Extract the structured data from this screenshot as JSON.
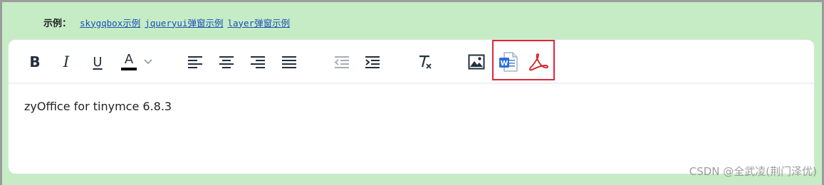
{
  "examples": {
    "label": "示例：",
    "links": [
      "skygqbox示例",
      "jqueryui弹窗示例",
      "layer弹窗示例"
    ]
  },
  "toolbar": {
    "bold_label": "B",
    "italic_label": "I",
    "underline_label": "U",
    "font_color_label": "A"
  },
  "editor": {
    "content": "zyOffice for tinymce 6.8.3"
  },
  "watermark": "CSDN @全武凌(荆门泽优)",
  "colors": {
    "background": "#c6ecc6",
    "highlight": "#e0263a",
    "word_blue": "#2b6fd6",
    "pdf_red": "#d2232a"
  }
}
